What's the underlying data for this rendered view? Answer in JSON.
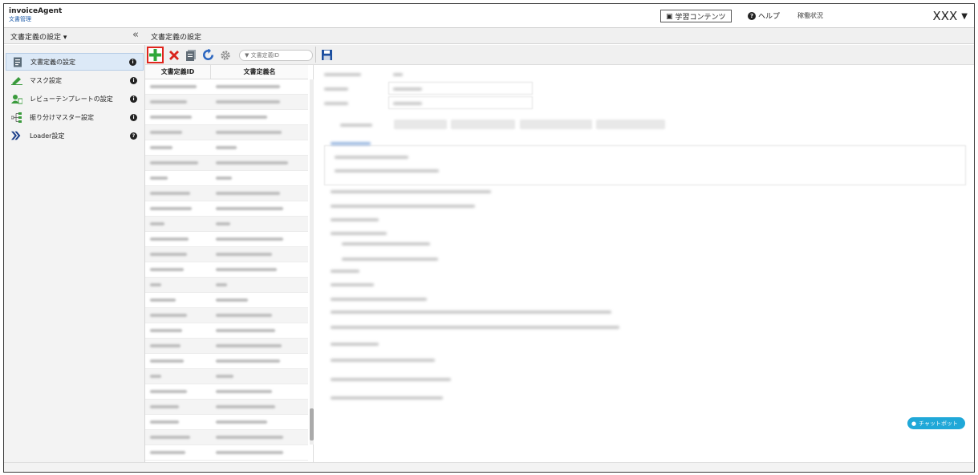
{
  "header": {
    "logo_line1": "invoiceAgent",
    "logo_line2": "文書管理",
    "learning_button": "学習コンテンツ",
    "help_label": "ヘルプ",
    "status_label": "稼働状況",
    "user_name": "XXX"
  },
  "subheader": {
    "section_menu": "文書定義の設定 ▾",
    "collapse_icon": "«",
    "breadcrumb": "文書定義の設定"
  },
  "sidebar": {
    "items": [
      {
        "label": "文書定義の設定",
        "icon": "document-icon",
        "active": true
      },
      {
        "label": "マスク設定",
        "icon": "pen-icon",
        "active": false
      },
      {
        "label": "レビューテンプレートの設定",
        "icon": "user-doc-icon",
        "active": false
      },
      {
        "label": "振り分けマスター設定",
        "icon": "sort-tree-icon",
        "active": false
      },
      {
        "label": "Loader設定",
        "icon": "loader-chevron-icon",
        "active": false
      }
    ]
  },
  "toolbar": {
    "search_placeholder": "▼ 文書定義ID"
  },
  "table": {
    "columns": [
      "文書定義ID",
      "文書定義名"
    ]
  },
  "chatbot": {
    "label": "チャットボット"
  },
  "colors": {
    "accent": "#1c5aa8",
    "add_green": "#2fa83a",
    "delete_red": "#d9241c",
    "highlight_red": "#e0251c",
    "chatbot_blue": "#20a8d8",
    "active_sidebar": "#dce9f7"
  }
}
